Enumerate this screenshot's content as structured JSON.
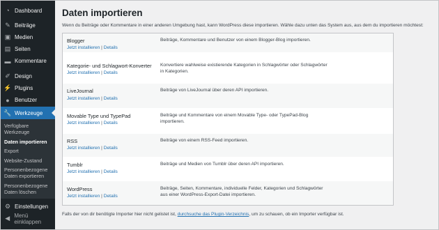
{
  "sidebar": {
    "dashboard": "Dashboard",
    "posts": "Beiträge",
    "media": "Medien",
    "pages": "Seiten",
    "comments": "Kommentare",
    "design": "Design",
    "plugins": "Plugins",
    "users": "Benutzer",
    "tools": "Werkzeuge",
    "sub": {
      "available_line1": "Verfügbare",
      "available_line2": "Werkzeuge",
      "import": "Daten importieren",
      "export": "Export",
      "site_health": "Website-Zustand",
      "export_personal_line1": "Personenbezogene",
      "export_personal_line2": "Daten exportieren",
      "erase_personal_line1": "Personenbezogene",
      "erase_personal_line2": "Daten löschen"
    },
    "settings": "Einstellungen",
    "collapse": "Menü einklappen"
  },
  "page": {
    "title": "Daten importieren",
    "intro": "Wenn du Beiträge oder Kommentare in einer anderen Umgebung hast, kann WordPress diese importieren. Wähle dazu unten das System aus, aus dem du importieren möchtest:"
  },
  "link_labels": {
    "install": "Jetzt installieren",
    "separator": "|",
    "details": "Details"
  },
  "importers": [
    {
      "name": "Blogger",
      "desc1": "Beiträge, Kommentare und Benutzer von einem Blogger-Blog importieren.",
      "desc2": ""
    },
    {
      "name": "Kategorie- und Schlagwort-Konverter",
      "desc1": "Konvertiere wahlweise existierende Kategorien in Schlagwörter oder Schlagwörter",
      "desc2": "in Kategorien."
    },
    {
      "name": "LiveJournal",
      "desc1": "Beiträge von LiveJournal über deren API importieren.",
      "desc2": ""
    },
    {
      "name": "Movable Type und TypePad",
      "desc1": "Beiträge und Kommentare von einem Movable Type- oder TypePad-Blog",
      "desc2": "importieren."
    },
    {
      "name": "RSS",
      "desc1": "Beiträge von einem RSS-Feed importieren.",
      "desc2": ""
    },
    {
      "name": "Tumblr",
      "desc1": "Beiträge und Medien von Tumblr über deren API importieren.",
      "desc2": ""
    },
    {
      "name": "WordPress",
      "desc1": "Beiträge, Seiten, Kommentare, individuelle Felder, Kategorien und Schlagwörter",
      "desc2": "aus einer WordPress-Export-Datei importieren."
    }
  ],
  "footer": {
    "before": "Falls der von dir benötigte Importer hier nicht gelistet ist, ",
    "link": "durchsuche das Plugin-Verzeichnis",
    "after": ", um zu schauen, ob ein Importer verfügbar ist."
  }
}
